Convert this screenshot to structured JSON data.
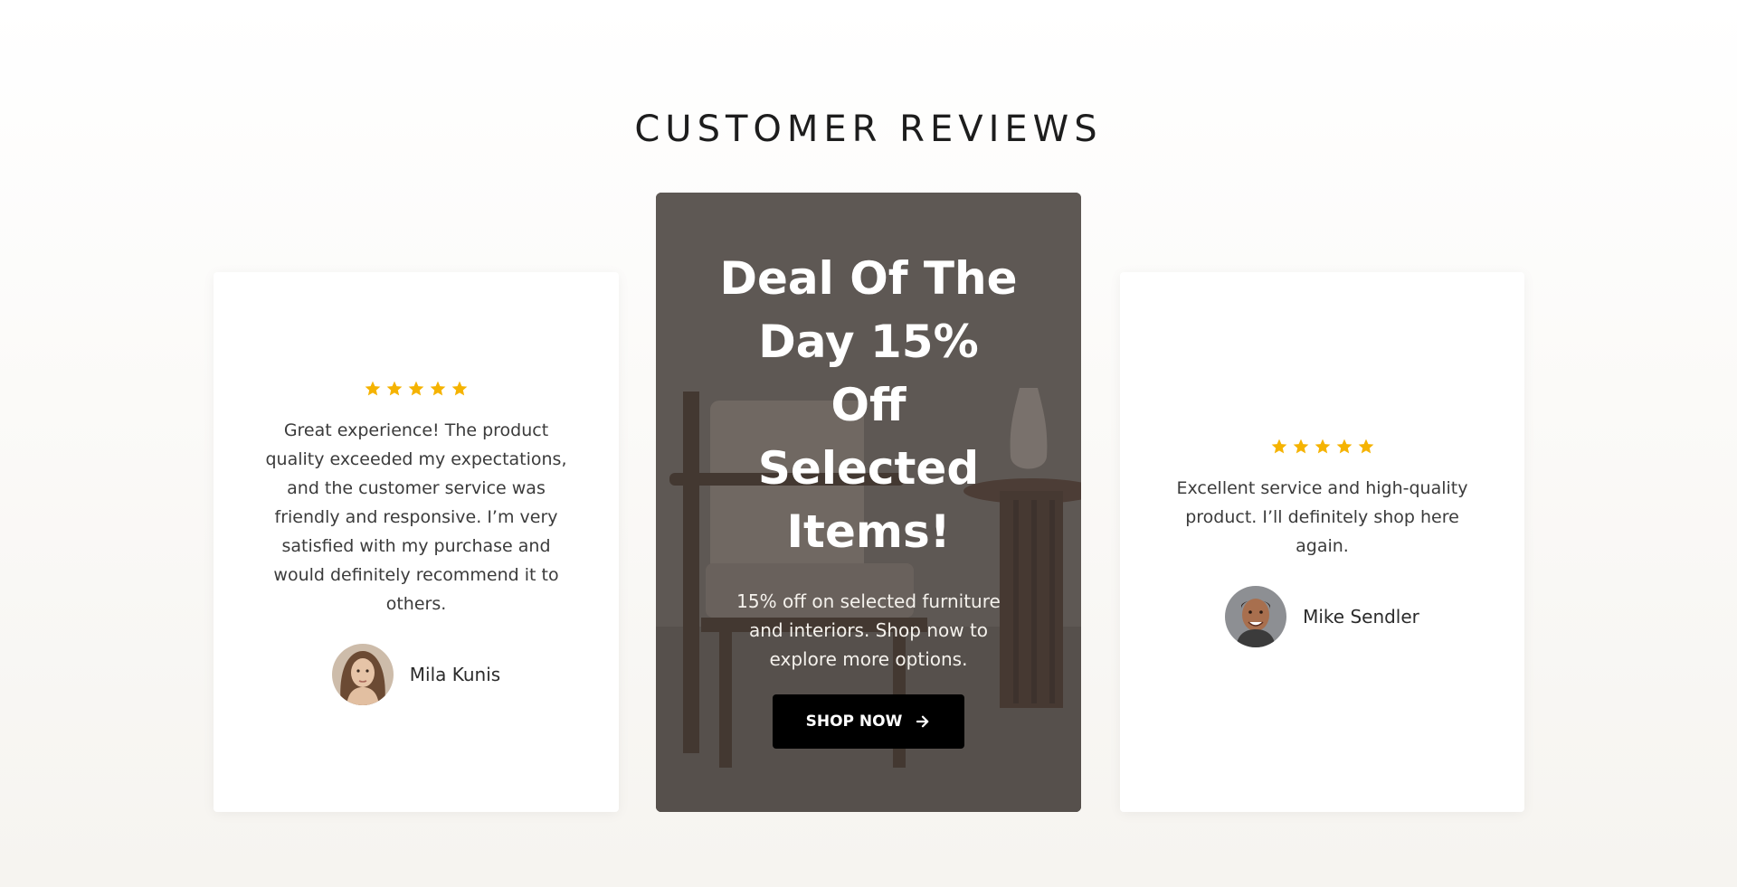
{
  "section": {
    "title": "CUSTOMER REVIEWS"
  },
  "reviews": [
    {
      "rating": 5,
      "text": "Great experience! The product quality exceeded my expectations, and the customer service was friendly and responsive. I’m very satisfied with my purchase and would definitely recommend it to others.",
      "name": "Mila Kunis",
      "avatar_icon": "avatar-woman"
    },
    {
      "rating": 5,
      "text": "Excellent service and high-quality product. I’ll definitely shop here again.",
      "name": "Mike Sendler",
      "avatar_icon": "avatar-man"
    }
  ],
  "promo": {
    "title": "Deal Of The Day 15% Off Selected Items!",
    "text": "15% off on selected furniture and interiors. Shop now to explore more options.",
    "button_label": "SHOP NOW",
    "button_icon": "arrow-right-icon",
    "background": "armchair-and-side-table-photo"
  },
  "colors": {
    "star": "#f5b301",
    "button_bg": "#000000",
    "promo_overlay": "#5a5551"
  }
}
